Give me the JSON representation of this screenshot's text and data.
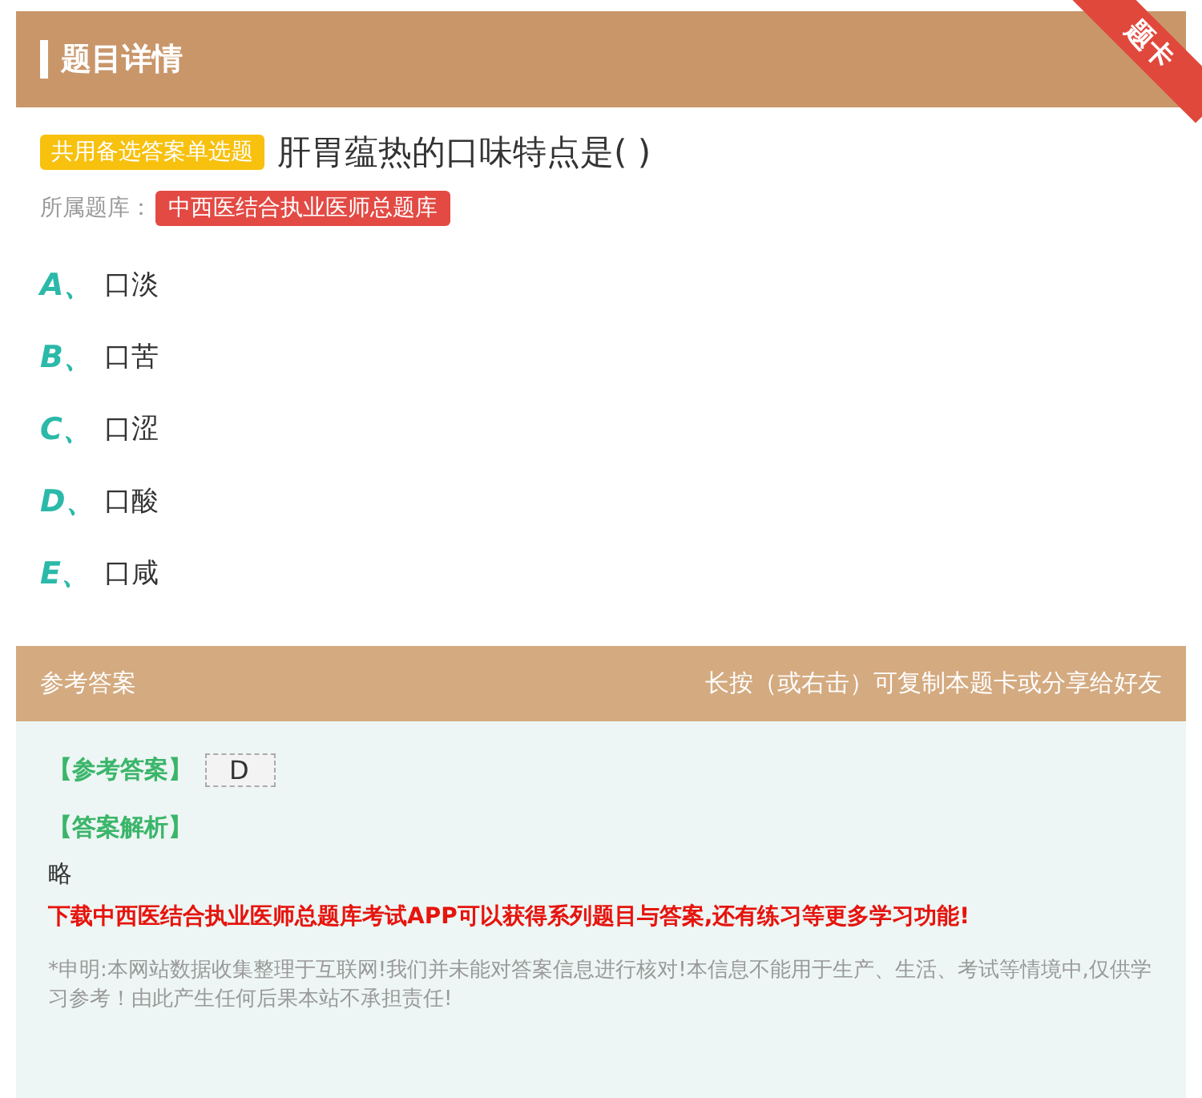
{
  "header": {
    "title": "题目详情",
    "ribbon": "题卡"
  },
  "question": {
    "tag": "共用备选答案单选题",
    "text": "肝胃蕴热的口味特点是( )",
    "bank_label": "所属题库：",
    "bank": "中西医结合执业医师总题库"
  },
  "options": [
    {
      "letter": "A",
      "sep": "、",
      "text": "口淡"
    },
    {
      "letter": "B",
      "sep": "、",
      "text": "口苦"
    },
    {
      "letter": "C",
      "sep": "、",
      "text": "口涩"
    },
    {
      "letter": "D",
      "sep": "、",
      "text": "口酸"
    },
    {
      "letter": "E",
      "sep": "、",
      "text": "口咸"
    }
  ],
  "answer_bar": {
    "title": "参考答案",
    "hint": "长按（或右击）可复制本题卡或分享给好友"
  },
  "answer": {
    "answer_label": "【参考答案】",
    "answer_value": "D",
    "analysis_label": "【答案解析】",
    "analysis": "略",
    "promo": "下载中西医结合执业医师总题库考试APP可以获得系列题目与答案,还有练习等更多学习功能!",
    "disclaimer": "*申明:本网站数据收集整理于互联网!我们并未能对答案信息进行核对!本信息不能用于生产、生活、考试等情境中,仅供学习参考！由此产生任何后果本站不承担责任!"
  }
}
